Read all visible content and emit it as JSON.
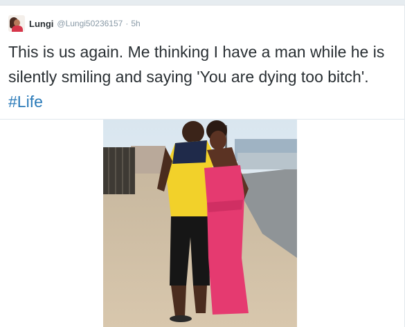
{
  "tweet": {
    "display_name": "Lungi",
    "handle": "@Lungi50236157",
    "separator": "·",
    "time": "5h",
    "text": "This is us again. Me thinking I have a man while he is silently smiling and saying 'You are dying too bitch'. ",
    "hashtag": "#Life",
    "icons": {
      "avatar": "profile-photo",
      "media": "photo"
    },
    "colors": {
      "name": "#292f33",
      "meta": "#8899a6",
      "hashtag": "#2b7bb9"
    }
  }
}
